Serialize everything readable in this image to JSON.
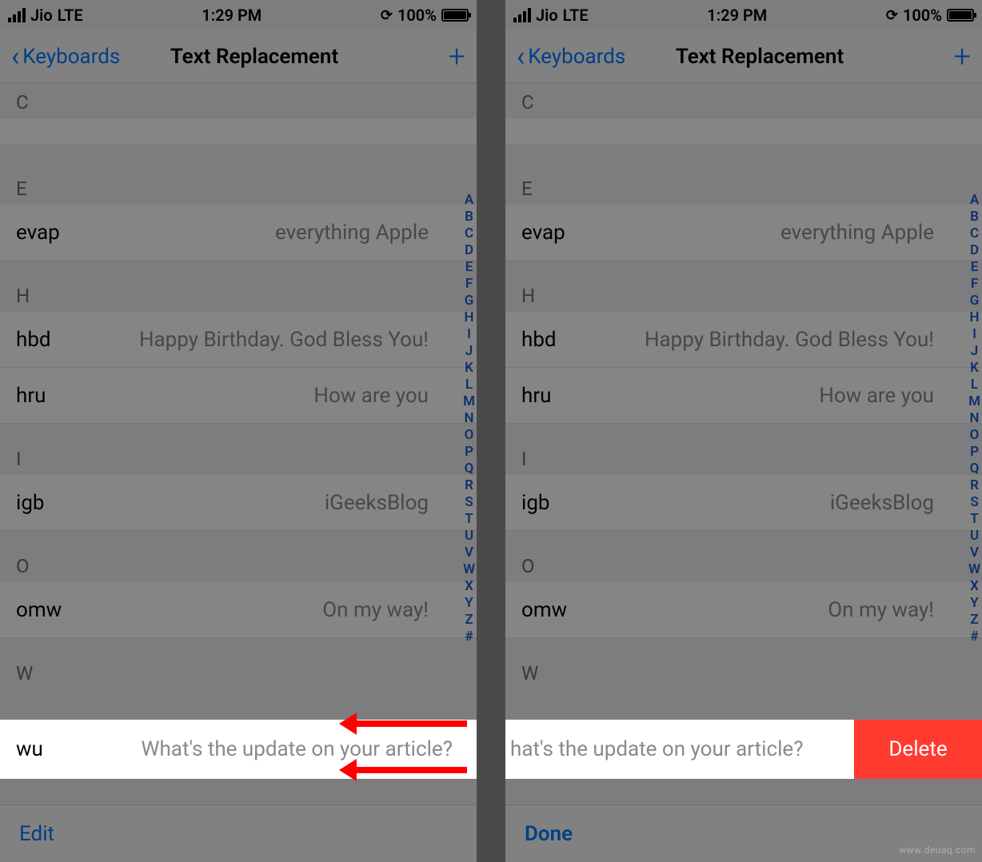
{
  "status": {
    "carrier": "Jio",
    "network": "LTE",
    "time": "1:29 PM",
    "battery_pct": "100%"
  },
  "nav": {
    "back_label": "Keyboards",
    "title": "Text Replacement",
    "add_glyph": "+"
  },
  "sections": [
    {
      "letter": "C",
      "rows": []
    },
    {
      "letter": "E",
      "rows": [
        {
          "shortcut": "evap",
          "phrase": "everything Apple"
        }
      ]
    },
    {
      "letter": "H",
      "rows": [
        {
          "shortcut": "hbd",
          "phrase": "Happy Birthday. God Bless You!"
        },
        {
          "shortcut": "hru",
          "phrase": "How are you"
        }
      ]
    },
    {
      "letter": "I",
      "rows": [
        {
          "shortcut": "igb",
          "phrase": "iGeeksBlog"
        }
      ]
    },
    {
      "letter": "O",
      "rows": [
        {
          "shortcut": "omw",
          "phrase": "On my way!"
        }
      ]
    },
    {
      "letter": "W",
      "rows": []
    }
  ],
  "highlight": {
    "shortcut": "wu",
    "phrase": "What's the update on your article?",
    "phrase_shifted": "hat's the update on your article?",
    "delete_label": "Delete"
  },
  "toolbar": {
    "edit_label": "Edit",
    "done_label": "Done"
  },
  "index_letters": [
    "A",
    "B",
    "C",
    "D",
    "E",
    "F",
    "G",
    "H",
    "I",
    "J",
    "K",
    "L",
    "M",
    "N",
    "O",
    "P",
    "Q",
    "R",
    "S",
    "T",
    "U",
    "V",
    "W",
    "X",
    "Y",
    "Z",
    "#"
  ],
  "watermark": "www.deuaq.com"
}
